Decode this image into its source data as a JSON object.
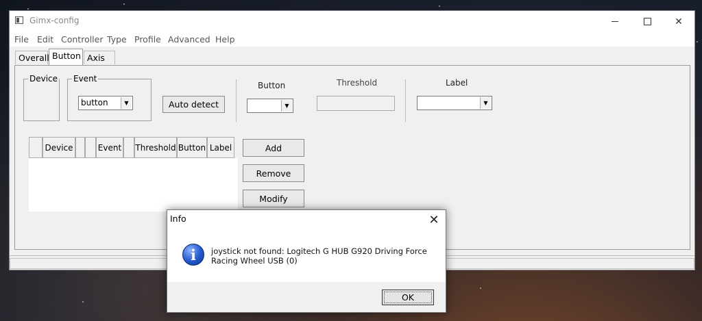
{
  "window": {
    "title": "Gimx-config",
    "minimize": "",
    "maximize": "",
    "close": "✕"
  },
  "menu": [
    "File",
    "Edit",
    "Controller",
    "Type",
    "Profile",
    "Advanced",
    "Help"
  ],
  "tabs": [
    {
      "label": "Overall",
      "active": false
    },
    {
      "label": "Button",
      "active": true
    },
    {
      "label": "Axis",
      "active": false
    }
  ],
  "button_tab": {
    "device_group": "Device",
    "event_group": "Event",
    "event_value": "button",
    "auto_detect": "Auto detect",
    "button_label": "Button",
    "button_value": "",
    "threshold_label": "Threshold",
    "threshold_value": "",
    "label_label": "Label",
    "label_value": "",
    "columns": [
      "",
      "Device",
      "",
      "",
      "Event",
      "",
      "Threshold",
      "Button",
      "Label"
    ],
    "add": "Add",
    "remove": "Remove",
    "modify": "Modify"
  },
  "dialog": {
    "title": "Info",
    "close": "✕",
    "icon": "info-icon",
    "icon_glyph": "i",
    "message": "joystick not found: Logitech G HUB G920 Driving Force Racing Wheel USB (0)",
    "ok": "OK"
  }
}
